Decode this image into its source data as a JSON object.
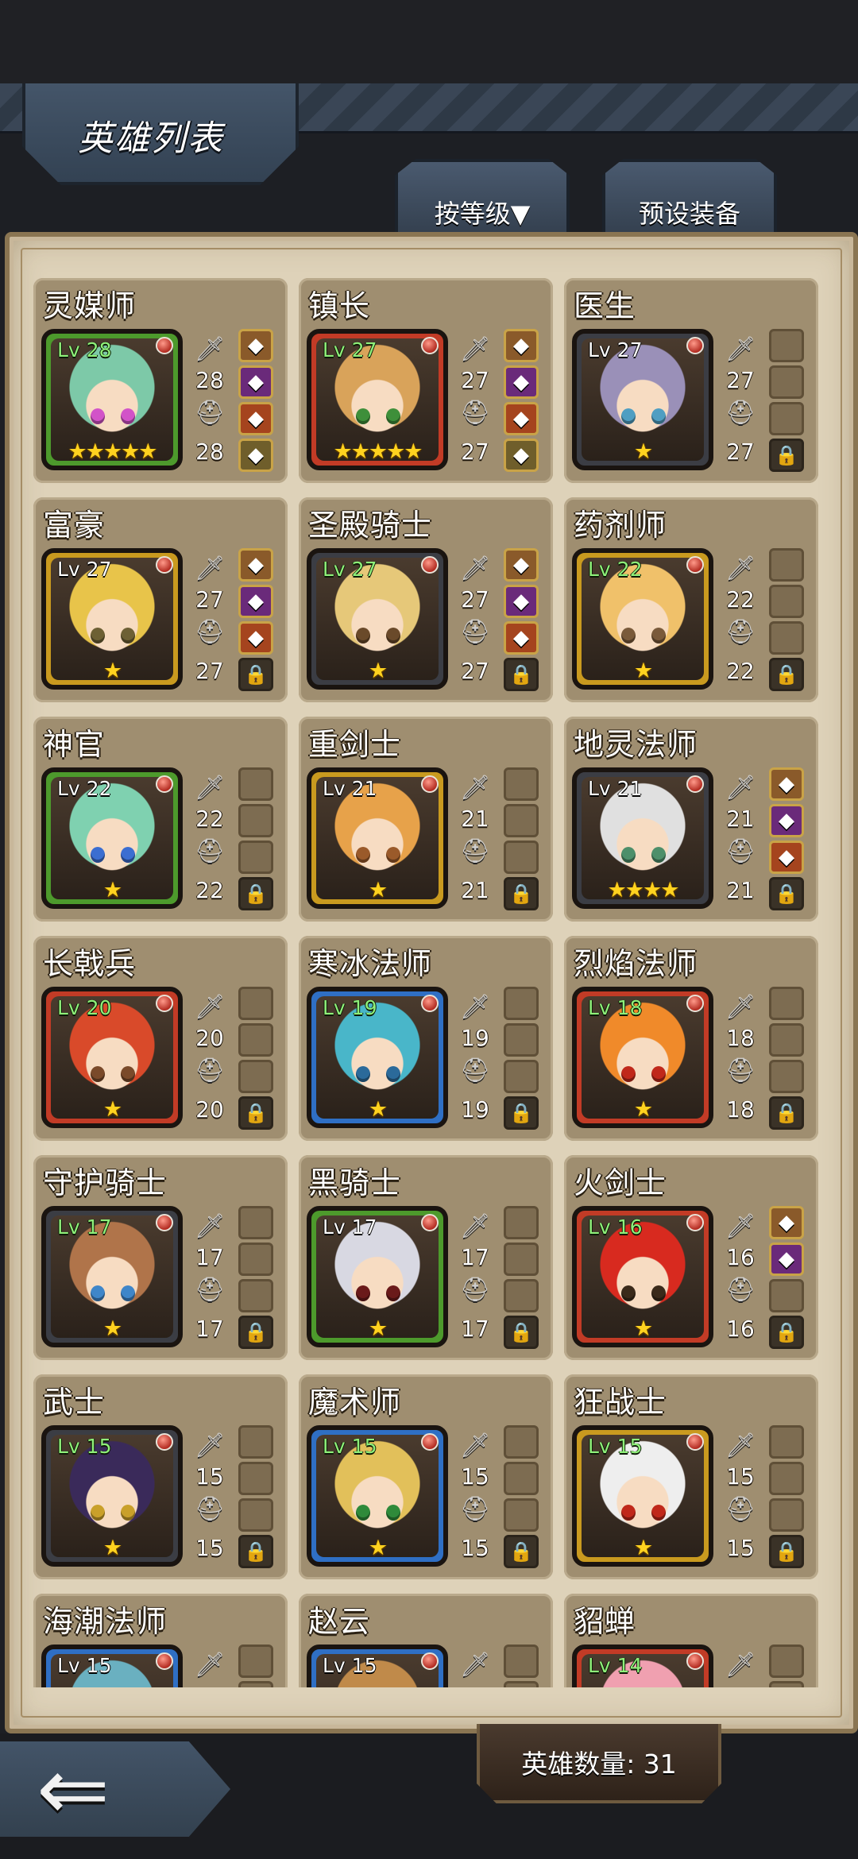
{
  "screen_title": "英雄列表",
  "tabs": {
    "sort": "按等级▼",
    "preset": "预设装备"
  },
  "hero_count_label": "英雄数量: 31",
  "heroes": [
    {
      "name": "灵媒师",
      "level": "Lv 28",
      "stars": "★★★★★",
      "atk": "28",
      "def": "28",
      "slots": [
        "equip",
        "equip",
        "equip",
        "equip"
      ],
      "frame": "#4d9a2c",
      "hair": "#7dc9a8",
      "eye": "#d253c8",
      "lv_white": false
    },
    {
      "name": "镇长",
      "level": "Lv 27",
      "stars": "★★★★★",
      "atk": "27",
      "def": "27",
      "slots": [
        "equip",
        "equip",
        "equip",
        "equip"
      ],
      "frame": "#c23b26",
      "hair": "#d9a35a",
      "eye": "#3e8f3a",
      "lv_white": false
    },
    {
      "name": "医生",
      "level": "Lv 27",
      "stars": "★",
      "atk": "27",
      "def": "27",
      "slots": [
        "empty",
        "empty",
        "empty",
        "lock"
      ],
      "frame": "#3b3d44",
      "hair": "#9a90b8",
      "eye": "#4f9ec2",
      "lv_white": true
    },
    {
      "name": "富豪",
      "level": "Lv 27",
      "stars": "★",
      "atk": "27",
      "def": "27",
      "slots": [
        "equip",
        "equip",
        "equip",
        "lock"
      ],
      "frame": "#c99a1f",
      "hair": "#e8c44a",
      "eye": "#6d6034",
      "lv_white": true
    },
    {
      "name": "圣殿骑士",
      "level": "Lv 27",
      "stars": "★",
      "atk": "27",
      "def": "27",
      "slots": [
        "equip",
        "equip",
        "equip",
        "lock"
      ],
      "frame": "#3b3d44",
      "hair": "#e6c879",
      "eye": "#6a4a2a",
      "lv_white": false
    },
    {
      "name": "药剂师",
      "level": "Lv 22",
      "stars": "★",
      "atk": "22",
      "def": "22",
      "slots": [
        "empty",
        "empty",
        "empty",
        "lock"
      ],
      "frame": "#c99a1f",
      "hair": "#f0c16a",
      "eye": "#7a5a3a",
      "lv_white": false
    },
    {
      "name": "神官",
      "level": "Lv 22",
      "stars": "★",
      "atk": "22",
      "def": "22",
      "slots": [
        "empty",
        "empty",
        "empty",
        "lock"
      ],
      "frame": "#4d9a2c",
      "hair": "#7fd1b0",
      "eye": "#3b6ed1",
      "lv_white": true
    },
    {
      "name": "重剑士",
      "level": "Lv 21",
      "stars": "★",
      "atk": "21",
      "def": "21",
      "slots": [
        "empty",
        "empty",
        "empty",
        "lock"
      ],
      "frame": "#c99a1f",
      "hair": "#e7a24a",
      "eye": "#9a5a2a",
      "lv_white": true
    },
    {
      "name": "地灵法师",
      "level": "Lv 21",
      "stars": "★★★★",
      "atk": "21",
      "def": "21",
      "slots": [
        "equip",
        "equip",
        "equip",
        "lock"
      ],
      "frame": "#3b3d44",
      "hair": "#e0e0e0",
      "eye": "#4d8f6a",
      "lv_white": true
    },
    {
      "name": "长戟兵",
      "level": "Lv 20",
      "stars": "★",
      "atk": "20",
      "def": "20",
      "slots": [
        "empty",
        "empty",
        "empty",
        "lock"
      ],
      "frame": "#c23b26",
      "hair": "#d94a2a",
      "eye": "#7a4a2a",
      "lv_white": false
    },
    {
      "name": "寒冰法师",
      "level": "Lv 19",
      "stars": "★",
      "atk": "19",
      "def": "19",
      "slots": [
        "empty",
        "empty",
        "empty",
        "lock"
      ],
      "frame": "#2f6fc4",
      "hair": "#49b6c9",
      "eye": "#2b6a9a",
      "lv_white": false
    },
    {
      "name": "烈焰法师",
      "level": "Lv 18",
      "stars": "★",
      "atk": "18",
      "def": "18",
      "slots": [
        "empty",
        "empty",
        "empty",
        "lock"
      ],
      "frame": "#c23b26",
      "hair": "#f08a2a",
      "eye": "#c0281a",
      "lv_white": false
    },
    {
      "name": "守护骑士",
      "level": "Lv 17",
      "stars": "★",
      "atk": "17",
      "def": "17",
      "slots": [
        "empty",
        "empty",
        "empty",
        "lock"
      ],
      "frame": "#3b3d44",
      "hair": "#b0744a",
      "eye": "#3f86c9",
      "lv_white": false
    },
    {
      "name": "黑骑士",
      "level": "Lv 17",
      "stars": "★",
      "atk": "17",
      "def": "17",
      "slots": [
        "empty",
        "empty",
        "empty",
        "lock"
      ],
      "frame": "#4d9a2c",
      "hair": "#d8d8e2",
      "eye": "#6a1a1a",
      "lv_white": true
    },
    {
      "name": "火剑士",
      "level": "Lv 16",
      "stars": "★",
      "atk": "16",
      "def": "16",
      "slots": [
        "equip",
        "equip",
        "empty",
        "lock"
      ],
      "frame": "#c23b26",
      "hair": "#d82a1f",
      "eye": "#3a2a1a",
      "lv_white": false
    },
    {
      "name": "武士",
      "level": "Lv 15",
      "stars": "★",
      "atk": "15",
      "def": "15",
      "slots": [
        "empty",
        "empty",
        "empty",
        "lock"
      ],
      "frame": "#3b3d44",
      "hair": "#3a2a5a",
      "eye": "#c9a02a",
      "lv_white": false
    },
    {
      "name": "魔术师",
      "level": "Lv 15",
      "stars": "★",
      "atk": "15",
      "def": "15",
      "slots": [
        "empty",
        "empty",
        "empty",
        "lock"
      ],
      "frame": "#2f6fc4",
      "hair": "#e2c05a",
      "eye": "#2f8a3a",
      "lv_white": false
    },
    {
      "name": "狂战士",
      "level": "Lv 15",
      "stars": "★",
      "atk": "15",
      "def": "15",
      "slots": [
        "empty",
        "empty",
        "empty",
        "lock"
      ],
      "frame": "#c99a1f",
      "hair": "#eeeeee",
      "eye": "#c0281a",
      "lv_white": false
    },
    {
      "name": "海潮法师",
      "level": "Lv 15",
      "stars": "",
      "atk": "",
      "def": "",
      "slots": [
        "empty",
        "empty",
        "empty",
        "lock"
      ],
      "frame": "#2f6fc4",
      "hair": "#6ab0c0",
      "eye": "#2f6a9a",
      "lv_white": true
    },
    {
      "name": "赵云",
      "level": "Lv 15",
      "stars": "",
      "atk": "",
      "def": "",
      "slots": [
        "empty",
        "empty",
        "empty",
        "lock"
      ],
      "frame": "#2f6fc4",
      "hair": "#c08a4a",
      "eye": "#5a3a2a",
      "lv_white": true
    },
    {
      "name": "貂蝉",
      "level": "Lv 14",
      "stars": "",
      "atk": "",
      "def": "",
      "slots": [
        "empty",
        "empty",
        "empty",
        "lock"
      ],
      "frame": "#c23b26",
      "hair": "#f0a0b0",
      "eye": "#7a3a5a",
      "lv_white": false
    }
  ],
  "icons": {
    "sword": "sword-icon",
    "helmet": "helmet-icon",
    "lock": "lock-icon",
    "back": "back-arrow-icon"
  }
}
